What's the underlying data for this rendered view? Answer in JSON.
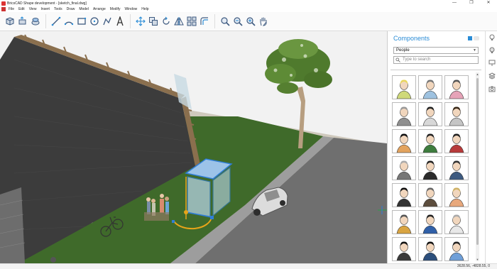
{
  "window": {
    "title": "BricsCAD Shape development - [sketch_final.dwg]",
    "controls": [
      "—",
      "❐",
      "✕"
    ]
  },
  "menu": [
    "File",
    "Edit",
    "View",
    "Insert",
    "Tools",
    "Draw",
    "Model",
    "Arrange",
    "Modify",
    "Window",
    "Help"
  ],
  "toolbar": {
    "tools": [
      "box-tool",
      "push-pull-tool",
      "extrude-tool",
      "line-tool",
      "arc-tool",
      "rectangle-tool",
      "circle-tool",
      "polyline-tool",
      "text-tool",
      "move-tool",
      "copy-tool",
      "rotate-tool",
      "mirror-tool",
      "array-tool",
      "offset-tool",
      "zoom-extents-tool",
      "zoom-out-tool",
      "zoom-in-tool",
      "pan-tool"
    ]
  },
  "components": {
    "title": "Components",
    "category": "People",
    "search_placeholder": "Type to search",
    "thumbnails": [
      "person-1",
      "person-2",
      "person-3",
      "person-4",
      "person-5",
      "person-6",
      "person-7",
      "person-8",
      "person-9",
      "person-10",
      "person-11",
      "person-12",
      "person-13",
      "person-14",
      "person-15",
      "person-16",
      "person-17",
      "person-18",
      "person-19",
      "person-20",
      "person-21"
    ]
  },
  "rail": [
    "lightbulb-icon",
    "bulb-outline-icon",
    "lamp-icon",
    "layers-icon",
    "camera-icon"
  ],
  "status": {
    "coordinates": "3628.56, -4828.55, 0"
  },
  "colors": {
    "accent": "#2a8cd6",
    "grass": "#3f6a2a",
    "road": "#6e6e6e",
    "selection": "#2f7ed8"
  }
}
